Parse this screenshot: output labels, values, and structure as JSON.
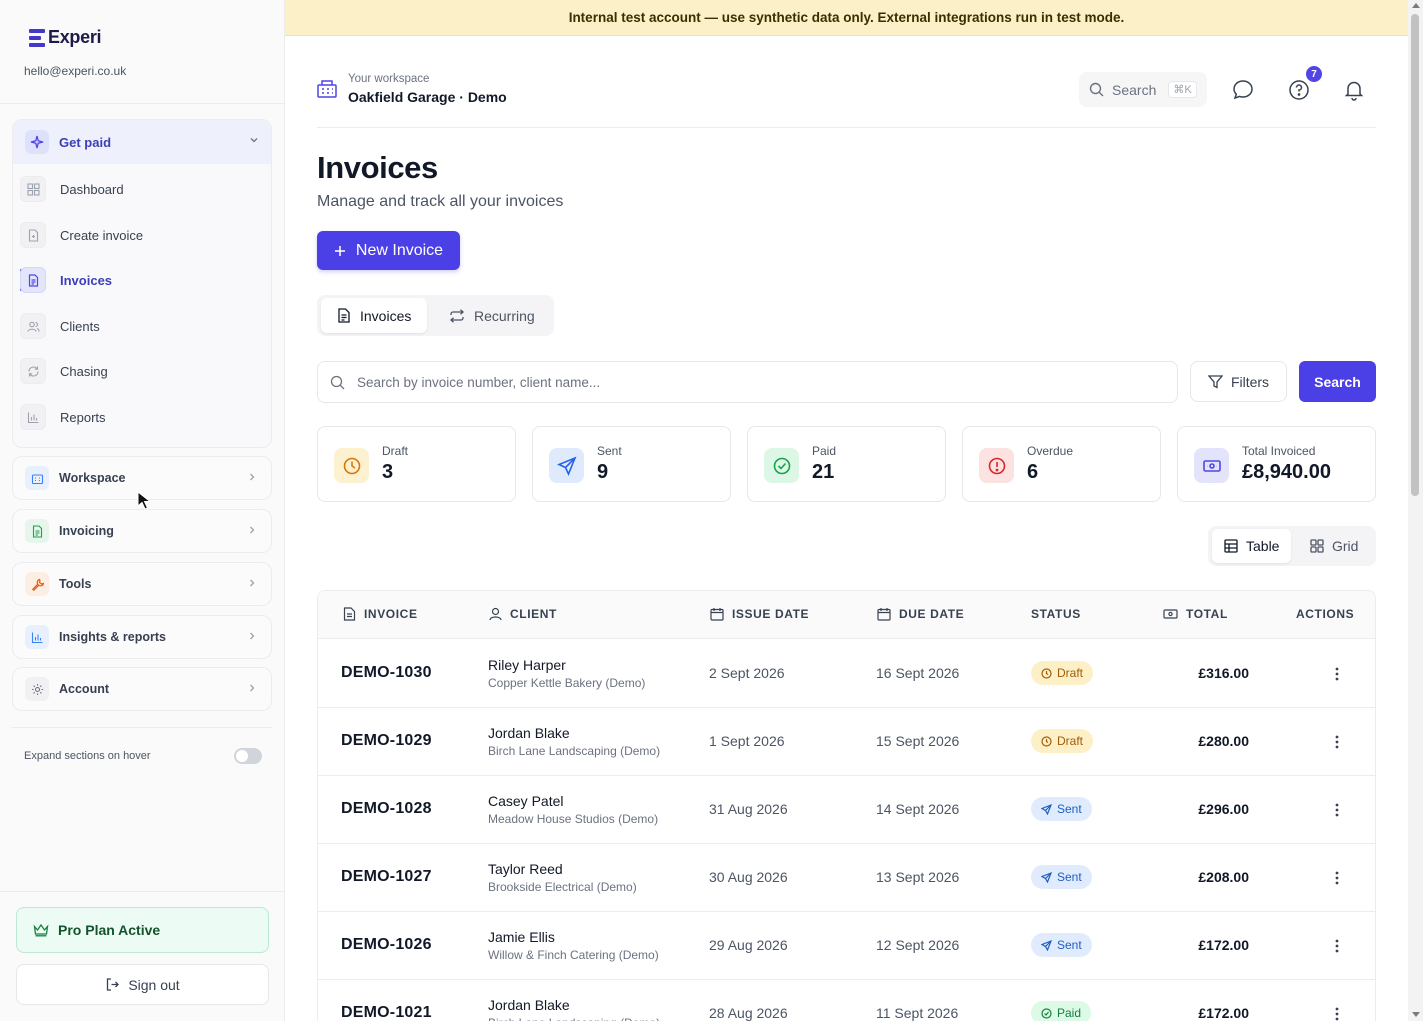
{
  "brand": {
    "name": "Experi",
    "email": "hello@experi.co.uk"
  },
  "sidebar": {
    "get_paid": {
      "label": "Get paid",
      "items": [
        {
          "label": "Dashboard",
          "icon": "dashboard-icon"
        },
        {
          "label": "Create invoice",
          "icon": "file-plus-icon"
        },
        {
          "label": "Invoices",
          "icon": "file-text-icon",
          "active": true
        },
        {
          "label": "Clients",
          "icon": "users-icon"
        },
        {
          "label": "Chasing",
          "icon": "refresh-icon"
        },
        {
          "label": "Reports",
          "icon": "bar-chart-icon"
        }
      ]
    },
    "groups": [
      {
        "label": "Workspace",
        "icon": "building-icon",
        "color": "#3b82f6"
      },
      {
        "label": "Invoicing",
        "icon": "document-icon",
        "color": "#16a34a"
      },
      {
        "label": "Tools",
        "icon": "wrench-icon",
        "color": "#ea580c"
      },
      {
        "label": "Insights & reports",
        "icon": "bar-chart-icon",
        "color": "#3b82f6"
      },
      {
        "label": "Account",
        "icon": "gear-icon",
        "color": "#6b7280"
      }
    ],
    "expand_label": "Expand sections on hover",
    "expand_on_hover": false,
    "plan_label": "Pro Plan Active",
    "signout_label": "Sign out"
  },
  "banner": {
    "text": "Internal test account — use synthetic data only. External integrations run in test mode."
  },
  "header": {
    "workspace_label": "Your workspace",
    "workspace_name": "Oakfield Garage · Demo",
    "search_label": "Search",
    "search_shortcut": "⌘K",
    "help_badge": "7"
  },
  "page": {
    "title": "Invoices",
    "subtitle": "Manage and track all your invoices",
    "new_invoice_label": "New Invoice",
    "tabs": [
      "Invoices",
      "Recurring"
    ],
    "search_placeholder": "Search by invoice number, client name...",
    "filters_label": "Filters",
    "search_button_label": "Search"
  },
  "stats": [
    {
      "label": "Draft",
      "value": "3",
      "color": "#f59e0b"
    },
    {
      "label": "Sent",
      "value": "9",
      "color": "#3b82f6"
    },
    {
      "label": "Paid",
      "value": "21",
      "color": "#16a34a"
    },
    {
      "label": "Overdue",
      "value": "6",
      "color": "#dc2626"
    },
    {
      "label": "Total Invoiced",
      "value": "£8,940.00",
      "color": "#4f46e5"
    }
  ],
  "view_toggle": [
    "Table",
    "Grid"
  ],
  "table": {
    "columns": [
      "INVOICE",
      "CLIENT",
      "ISSUE DATE",
      "DUE DATE",
      "STATUS",
      "TOTAL",
      "ACTIONS"
    ],
    "rows": [
      {
        "invoice": "DEMO-1030",
        "client": "Riley Harper",
        "company": "Copper Kettle Bakery (Demo)",
        "issue": "2 Sept 2026",
        "due": "16 Sept 2026",
        "status": "Draft",
        "total": "£316.00"
      },
      {
        "invoice": "DEMO-1029",
        "client": "Jordan Blake",
        "company": "Birch Lane Landscaping (Demo)",
        "issue": "1 Sept 2026",
        "due": "15 Sept 2026",
        "status": "Draft",
        "total": "£280.00"
      },
      {
        "invoice": "DEMO-1028",
        "client": "Casey Patel",
        "company": "Meadow House Studios (Demo)",
        "issue": "31 Aug 2026",
        "due": "14 Sept 2026",
        "status": "Sent",
        "total": "£296.00"
      },
      {
        "invoice": "DEMO-1027",
        "client": "Taylor Reed",
        "company": "Brookside Electrical (Demo)",
        "issue": "30 Aug 2026",
        "due": "13 Sept 2026",
        "status": "Sent",
        "total": "£208.00"
      },
      {
        "invoice": "DEMO-1026",
        "client": "Jamie Ellis",
        "company": "Willow & Finch Catering (Demo)",
        "issue": "29 Aug 2026",
        "due": "12 Sept 2026",
        "status": "Sent",
        "total": "£172.00"
      },
      {
        "invoice": "DEMO-1021",
        "client": "Jordan Blake",
        "company": "Birch Lane Landscaping (Demo)",
        "issue": "28 Aug 2026",
        "due": "11 Sept 2026",
        "status": "Paid",
        "total": "£172.00"
      }
    ]
  },
  "colors": {
    "accent": "#4b3fe6",
    "banner": "#fbf0c8",
    "sidebar_bg": "#fafafa"
  }
}
